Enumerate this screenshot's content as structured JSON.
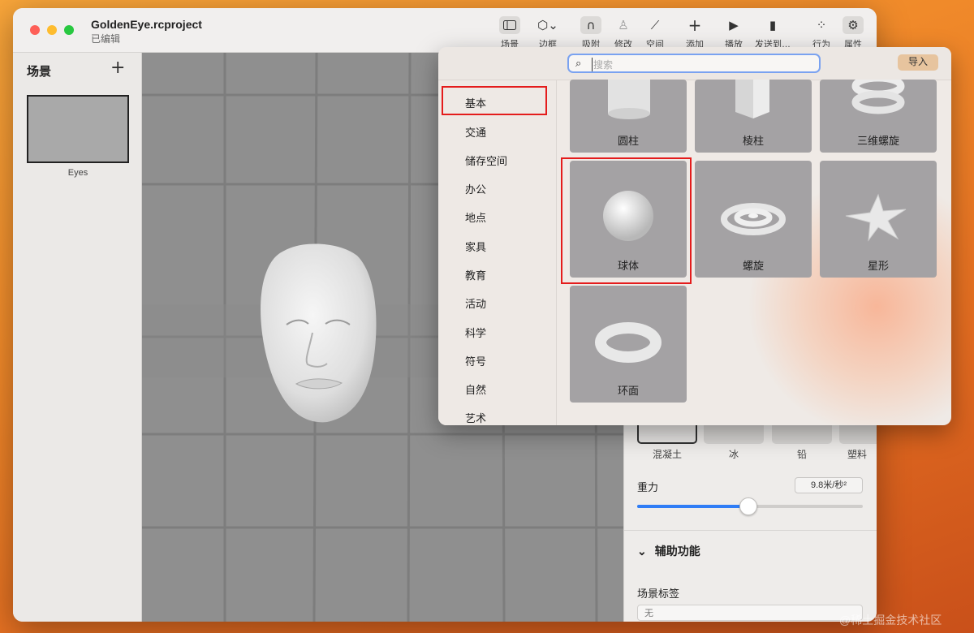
{
  "window": {
    "title": "GoldenEye.rcproject",
    "subtitle": "已编辑"
  },
  "toolbar": {
    "items": [
      {
        "label": "场景",
        "icon": "sidebar-icon"
      },
      {
        "label": "边框",
        "icon": "cube-icon"
      },
      {
        "label": "吸附",
        "icon": "magnet-icon"
      },
      {
        "label": "修改",
        "icon": "modify-icon"
      },
      {
        "label": "空间",
        "icon": "space-icon"
      },
      {
        "label": "添加",
        "icon": "plus-icon"
      },
      {
        "label": "播放",
        "icon": "play-icon"
      },
      {
        "label": "发送到…",
        "icon": "phone-icon"
      },
      {
        "label": "行为",
        "icon": "behavior-icon"
      },
      {
        "label": "属性",
        "icon": "gear-icon"
      }
    ]
  },
  "sidebar": {
    "title": "场景",
    "scenes": [
      {
        "name": "Eyes"
      }
    ]
  },
  "popover": {
    "search_placeholder": "搜索",
    "import_label": "导入",
    "categories": [
      "基本",
      "交通",
      "储存空间",
      "办公",
      "地点",
      "家具",
      "教育",
      "活动",
      "科学",
      "符号",
      "自然",
      "艺术"
    ],
    "selected_category": "基本",
    "items": [
      {
        "label": "圆柱"
      },
      {
        "label": "棱柱"
      },
      {
        "label": "三维螺旋"
      },
      {
        "label": "球体"
      },
      {
        "label": "螺旋"
      },
      {
        "label": "星形"
      },
      {
        "label": "环面"
      }
    ]
  },
  "inspector": {
    "materials": [
      {
        "label": "混凝土"
      },
      {
        "label": "冰"
      },
      {
        "label": "铅"
      },
      {
        "label": "塑料"
      }
    ],
    "gravity_label": "重力",
    "gravity_value": "9.8米/秒²",
    "gravity_slider_fraction": 0.49,
    "accessibility_header": "辅助功能",
    "scene_tag_label": "场景标签",
    "scene_tag_value": "无"
  },
  "watermark": "@稀土掘金技术社区"
}
